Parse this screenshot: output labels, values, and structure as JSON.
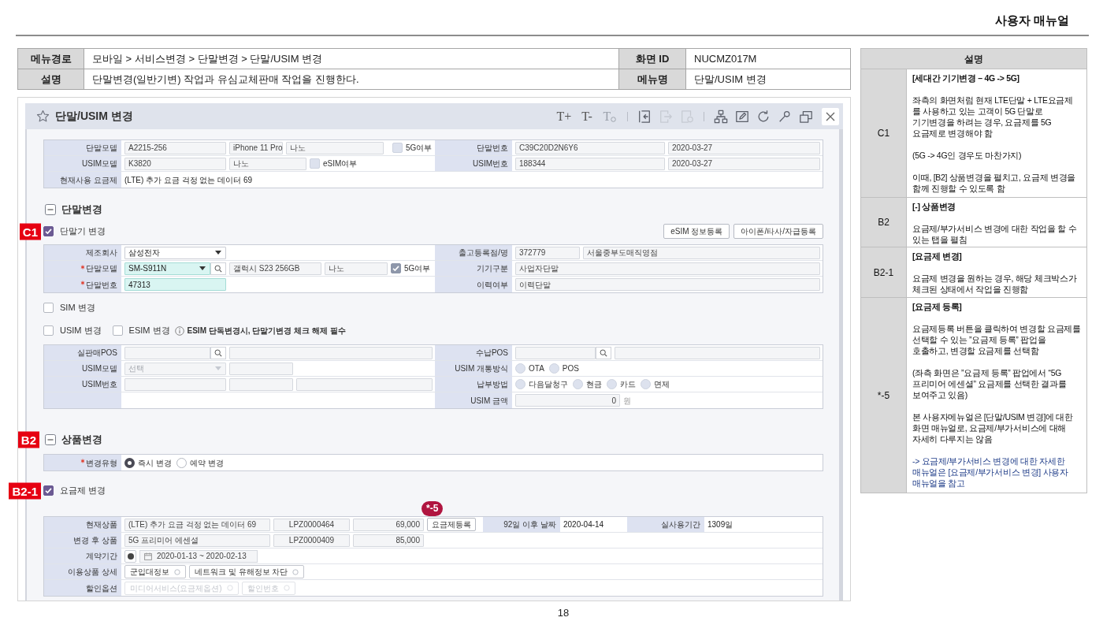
{
  "header": {
    "title": "사용자 매뉴얼"
  },
  "info_table": {
    "rows": [
      [
        {
          "label": "메뉴경로",
          "value": "모바일 > 서비스변경 > 단말변경 > 단말/USIM 변경"
        },
        {
          "label": "화면 ID",
          "value": "NUCMZ017M"
        }
      ],
      [
        {
          "label": "설명",
          "value": "단말변경(일반기변) 작업과 유심교체판매 작업을 진행한다."
        },
        {
          "label": "메뉴명",
          "value": "단말/USIM 변경"
        }
      ]
    ]
  },
  "screen": {
    "title": "단말/USIM 변경",
    "toolbar": [
      {
        "kind": "text",
        "label": "T+",
        "disabled": false
      },
      {
        "kind": "text",
        "label": "T-",
        "disabled": false
      },
      {
        "kind": "reset",
        "label": "T",
        "disabled": true
      },
      {
        "kind": "separator"
      },
      {
        "kind": "icon",
        "disabled": false
      },
      {
        "kind": "icon",
        "disabled": true
      },
      {
        "kind": "icon",
        "disabled": true
      },
      {
        "kind": "separator"
      },
      {
        "kind": "icon",
        "disabled": false
      },
      {
        "kind": "icon",
        "disabled": false
      },
      {
        "kind": "icon",
        "disabled": false
      },
      {
        "kind": "icon",
        "disabled": false
      },
      {
        "kind": "icon",
        "disabled": false
      },
      {
        "kind": "close"
      }
    ],
    "summary": {
      "rows": [
        [
          {
            "label": "단말모델",
            "required": false,
            "fields": [
              {
                "kind": "input",
                "value": "A2215-256",
                "highlighted": false
              },
              {
                "kind": "input",
                "value": "iPhone 11 Pro",
                "highlighted": false
              },
              {
                "kind": "input",
                "value": "나노",
                "highlighted": false
              },
              {
                "kind": "checkbox",
                "label": "5G여부",
                "checked": false,
                "disabled": true
              }
            ]
          },
          {
            "label": "단말번호",
            "required": false,
            "fields": [
              {
                "kind": "input",
                "value": "C39C20D2N6Y6",
                "highlighted": false
              },
              {
                "kind": "input",
                "value": "2020-03-27",
                "highlighted": false
              }
            ]
          }
        ],
        [
          {
            "label": "USIM모델",
            "required": false,
            "fields": [
              {
                "kind": "input",
                "value": "K3820",
                "highlighted": false
              },
              {
                "kind": "input",
                "value": "나노",
                "highlighted": false
              },
              {
                "kind": "checkbox",
                "label": "eSIM여부",
                "checked": false,
                "disabled": true
              }
            ]
          },
          {
            "label": "USIM번호",
            "required": false,
            "fields": [
              {
                "kind": "input",
                "value": "188344",
                "highlighted": false
              },
              {
                "kind": "input",
                "value": "2020-03-27",
                "highlighted": false
              }
            ]
          }
        ],
        [
          {
            "label": "현재사용 요금제",
            "required": false,
            "fields": [
              {
                "kind": "text",
                "value": "(LTE) 추가 요금 걱정 없는 데이터 69"
              }
            ]
          }
        ]
      ]
    },
    "sections": [
      {
        "title": "단말변경",
        "expanded": true,
        "blocks": [
          {
            "kind": "checks",
            "marker": "C1",
            "items": [
              {
                "label": "단말기 변경",
                "checked": true
              }
            ],
            "buttons": [
              "eSIM 정보등록",
              "아이폰/타사/자급등록"
            ]
          },
          {
            "kind": "form",
            "rows": [
              [
                {
                  "label": "제조회사",
                  "required": false,
                  "fields": [
                    {
                      "kind": "select",
                      "value": "삼성전자",
                      "highlighted": false,
                      "disabled": false
                    }
                  ]
                },
                {
                  "label": "출고등록점/명",
                  "required": false,
                  "fields": [
                    {
                      "kind": "input",
                      "value": "372779",
                      "highlighted": false
                    },
                    {
                      "kind": "input",
                      "value": "서울중부도매직영점",
                      "highlighted": false
                    }
                  ]
                }
              ],
              [
                {
                  "label": "단말모델",
                  "required": true,
                  "fields": [
                    {
                      "kind": "select",
                      "value": "SM-S911N",
                      "highlighted": true,
                      "disabled": false
                    },
                    {
                      "kind": "search"
                    },
                    {
                      "kind": "input",
                      "value": "갤럭시 S23 256GB",
                      "highlighted": false
                    },
                    {
                      "kind": "input",
                      "value": "나노",
                      "highlighted": false
                    },
                    {
                      "kind": "checkbox",
                      "label": "5G여부",
                      "checked": true,
                      "disabled": true
                    }
                  ]
                },
                {
                  "label": "기기구분",
                  "required": false,
                  "fields": [
                    {
                      "kind": "input",
                      "value": "사업자단말",
                      "highlighted": false
                    }
                  ]
                }
              ],
              [
                {
                  "label": "단말번호",
                  "required": true,
                  "fields": [
                    {
                      "kind": "input",
                      "value": "47313",
                      "highlighted": true
                    }
                  ]
                },
                {
                  "label": "이력여부",
                  "required": false,
                  "fields": [
                    {
                      "kind": "input",
                      "value": "이력단말",
                      "highlighted": false
                    }
                  ]
                }
              ]
            ]
          },
          {
            "kind": "checks",
            "items": [
              {
                "label": "SIM 변경",
                "checked": false
              }
            ]
          },
          {
            "kind": "checks",
            "items": [
              {
                "label": "USIM 변경",
                "checked": false
              },
              {
                "label": "ESIM 변경",
                "checked": false
              }
            ],
            "note": "ESIM 단독변경시, 단말기변경 체크 해제 필수"
          },
          {
            "kind": "form",
            "rows": [
              [
                {
                  "label": "실판매POS",
                  "required": false,
                  "fields": [
                    {
                      "kind": "input",
                      "highlighted": false
                    },
                    {
                      "kind": "search"
                    },
                    {
                      "kind": "input",
                      "highlighted": false
                    }
                  ]
                },
                {
                  "label": "수납POS",
                  "required": false,
                  "fields": [
                    {
                      "kind": "input",
                      "highlighted": false
                    },
                    {
                      "kind": "search"
                    },
                    {
                      "kind": "input",
                      "highlighted": false
                    }
                  ]
                }
              ],
              [
                {
                  "label": "USIM모델",
                  "required": false,
                  "fields": [
                    {
                      "kind": "select",
                      "placeholder": "선택",
                      "highlighted": false,
                      "disabled": true
                    },
                    {
                      "kind": "input",
                      "highlighted": false
                    }
                  ]
                },
                {
                  "label": "USIM 개통방식",
                  "required": false,
                  "fields": [
                    {
                      "kind": "radio",
                      "label": "OTA",
                      "selected": false,
                      "disabled": true
                    },
                    {
                      "kind": "radio",
                      "label": "POS",
                      "selected": false,
                      "disabled": true
                    }
                  ]
                }
              ],
              [
                {
                  "label": "USIM번호",
                  "required": false,
                  "fields": [
                    {
                      "kind": "input",
                      "highlighted": false
                    },
                    {
                      "kind": "input",
                      "highlighted": false
                    },
                    {
                      "kind": "input",
                      "highlighted": false
                    }
                  ]
                },
                {
                  "label": "납부방법",
                  "required": false,
                  "fields": [
                    {
                      "kind": "radio",
                      "label": "다음달청구",
                      "selected": false,
                      "disabled": true
                    },
                    {
                      "kind": "radio",
                      "label": "현금",
                      "selected": false,
                      "disabled": true
                    },
                    {
                      "kind": "radio",
                      "label": "카드",
                      "selected": false,
                      "disabled": true
                    },
                    {
                      "kind": "radio",
                      "label": "면제",
                      "selected": false,
                      "disabled": true
                    }
                  ]
                }
              ],
              [
                "",
                {
                  "label": "USIM 금액",
                  "required": false,
                  "fields": [
                    {
                      "kind": "input",
                      "value": "0",
                      "highlighted": false
                    },
                    {
                      "kind": "unit",
                      "value": "원"
                    }
                  ]
                }
              ]
            ]
          }
        ]
      },
      {
        "title": "상품변경",
        "expanded": true,
        "marker": "B2",
        "blocks": [
          {
            "kind": "form",
            "rows": [
              [
                {
                  "label": "변경유형",
                  "required": true,
                  "fields": [
                    {
                      "kind": "radio",
                      "label": "즉시 변경",
                      "selected": true,
                      "disabled": false
                    },
                    {
                      "kind": "radio",
                      "label": "예약 변경",
                      "selected": false,
                      "disabled": false
                    }
                  ]
                }
              ]
            ]
          },
          {
            "kind": "checks",
            "marker": "B2-1",
            "items": [
              {
                "label": "요금제 변경",
                "checked": true
              }
            ]
          },
          {
            "kind": "form",
            "rows": [
              [
                {
                  "label": "현재상품",
                  "required": false,
                  "fields": [
                    {
                      "kind": "input",
                      "value": "(LTE) 추가 요금 걱정 없는 데이터 69",
                      "highlighted": false
                    },
                    {
                      "kind": "input",
                      "value": "LPZ0000464",
                      "highlighted": false
                    },
                    {
                      "kind": "input",
                      "value": "69,000",
                      "highlighted": false
                    },
                    {
                      "kind": "button",
                      "label": "요금제등록",
                      "marker": "*-5"
                    }
                  ]
                },
                {
                  "label": "92일 이후 날짜",
                  "required": false,
                  "fields": [
                    {
                      "kind": "text",
                      "value": "2020-04-14"
                    }
                  ]
                },
                {
                  "label": "실사용기간",
                  "required": false,
                  "fields": [
                    {
                      "kind": "text",
                      "value": "1309일"
                    }
                  ]
                }
              ],
              [
                {
                  "label": "변경 후 상품",
                  "required": false,
                  "fields": [
                    {
                      "kind": "input",
                      "value": "5G 프리미어 에센셜",
                      "highlighted": false
                    },
                    {
                      "kind": "input",
                      "value": "LPZ0000409",
                      "highlighted": false
                    },
                    {
                      "kind": "input",
                      "value": "85,000",
                      "highlighted": false
                    }
                  ]
                }
              ],
              [
                {
                  "label": "계약기간",
                  "required": false,
                  "fields": [
                    {
                      "kind": "radio_box",
                      "selected": true
                    },
                    {
                      "kind": "date_range",
                      "value": "2020-01-13 ~ 2020-02-13"
                    }
                  ]
                }
              ],
              [
                {
                  "label": "이용상품 상세",
                  "required": false,
                  "fields": [
                    {
                      "kind": "chip",
                      "label": "군입대정보",
                      "disabled": false
                    },
                    {
                      "kind": "chip",
                      "label": "네트워크 및 유해정보 차단",
                      "disabled": false
                    }
                  ]
                }
              ],
              [
                {
                  "label": "할인옵션",
                  "required": false,
                  "fields": [
                    {
                      "kind": "chip",
                      "label": "미디어서비스(요금제옵션)",
                      "disabled": true
                    },
                    {
                      "kind": "chip",
                      "label": "할인번호",
                      "disabled": true
                    }
                  ]
                }
              ]
            ]
          }
        ]
      }
    ]
  },
  "notes": {
    "header": "설명",
    "rows": [
      {
        "key": "C1",
        "title": "[세대간 기기변경 – 4G -> 5G]",
        "paragraphs": [
          "좌측의 화면처럼 현재 LTE단말 + LTE요금제\n를 사용하고 있는 고객이 5G 단말로\n기기변경을 하려는 경우, 요금제를 5G\n요금제로 변경해야 함",
          "(5G -> 4G인 경우도 마찬가지)",
          "이때, [B2] 상품변경을 펼치고, 요금제 변경을\n함께 진행할 수 있도록 함"
        ]
      },
      {
        "key": "B2",
        "title": "[-] 상품변경",
        "paragraphs": [
          "요금제/부가서비스 변경에 대한 작업을 할 수\n있는 탭을 펼침"
        ]
      },
      {
        "key": "B2-1",
        "title": "[요금제 변경]",
        "paragraphs": [
          "요금제 변경을 원하는 경우, 해당 체크박스가\n체크된 상태에서 작업을 진행함"
        ]
      },
      {
        "key": "*-5",
        "title": "[요금제 등록]",
        "paragraphs": [
          "요금제등록 버튼을 클릭하여 변경할 요금제를\n선택할 수 있는 ”요금제 등록” 팝업을\n호출하고, 변경할 요금제를 선택함",
          "(좌측 화면은 ”요금제 등록” 팝업에서 “5G\n프리미어 에센셜” 요금제를 선택한 결과를\n보여주고 있음)",
          "본 사용자메뉴얼은 [단말/USIM 변경]에 대한\n화면 매뉴얼로, 요금제/부가서비스에 대해\n자세히 다루지는 않음"
        ],
        "reference": "-> 요금제/부가서비스 변경에 대한 자세한\n매뉴얼은 [요금제/부가서비스 변경] 사용자\n매뉴얼을 참고"
      }
    ]
  },
  "page_number": "18"
}
